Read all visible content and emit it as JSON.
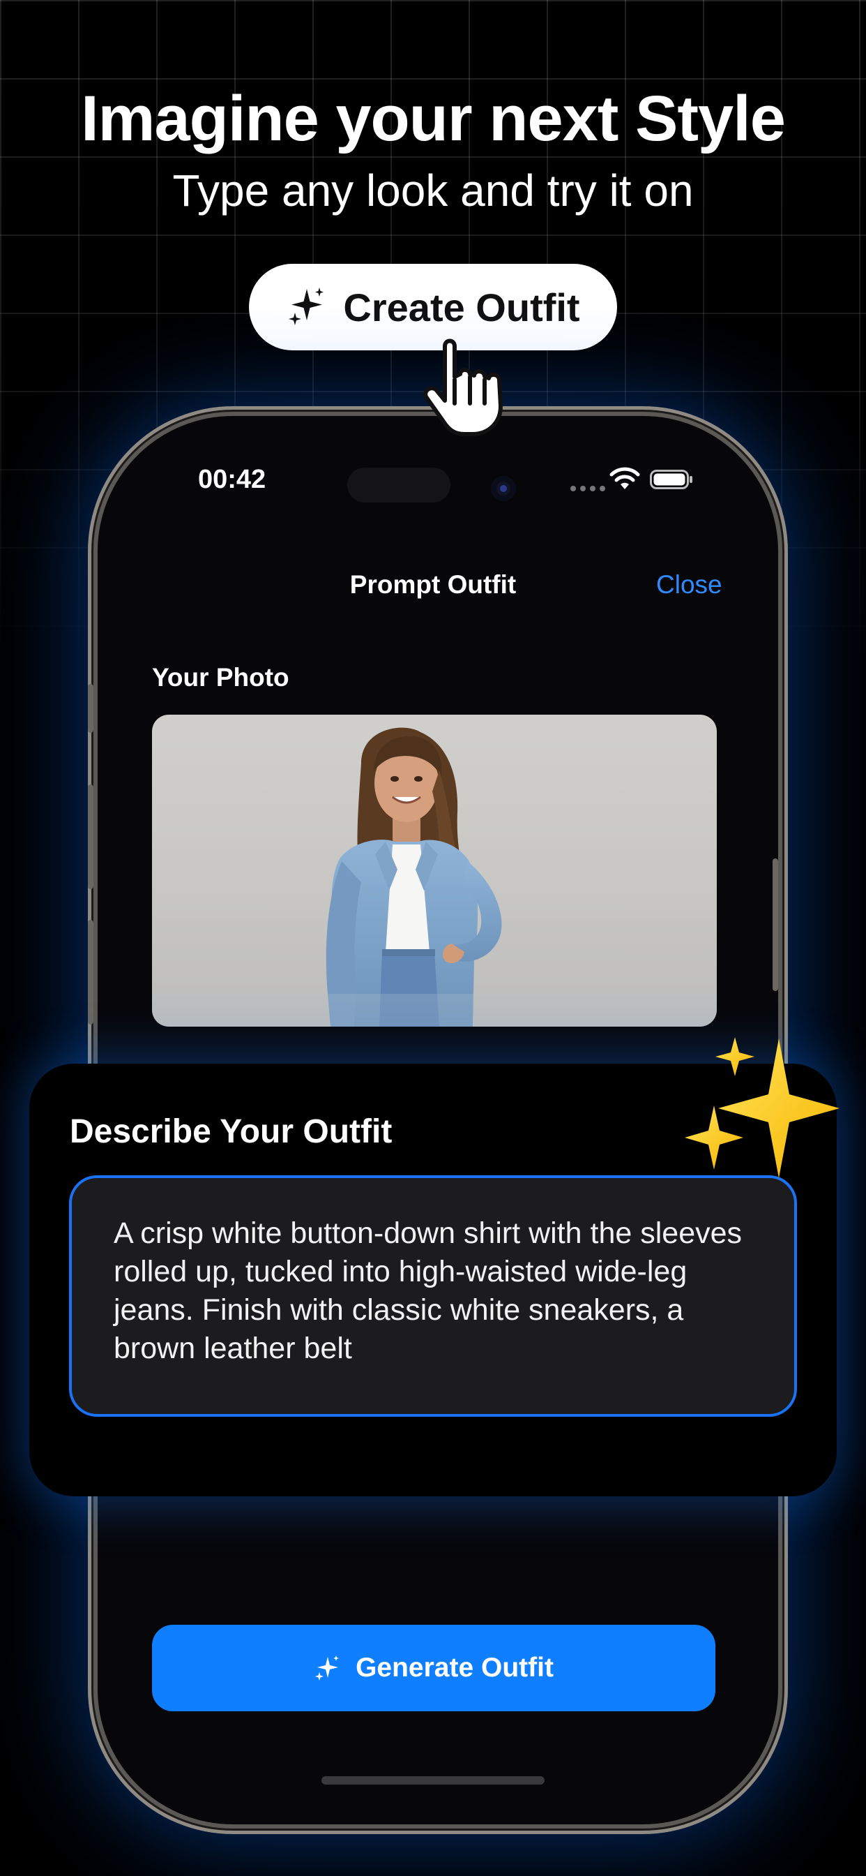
{
  "promo": {
    "headline": "Imagine your next Style",
    "subline": "Type any look and try it on",
    "create_button_label": "Create Outfit"
  },
  "status_bar": {
    "time": "00:42"
  },
  "nav": {
    "title": "Prompt Outfit",
    "close_label": "Close"
  },
  "photo_section": {
    "label": "Your Photo"
  },
  "describe": {
    "title": "Describe Your Outfit",
    "prompt_text": "A crisp white button-down shirt with the sleeves rolled up, tucked into high-waisted wide-leg jeans. Finish with classic white sneakers, a brown leather belt"
  },
  "generate_button_label": "Generate Outfit",
  "colors": {
    "accent_blue": "#0f7fff",
    "link_blue": "#2f8bff",
    "sparkle_yellow": "#ffd21f"
  },
  "icons": [
    "sparkle-icon",
    "hand-cursor-icon",
    "wifi-icon",
    "battery-icon"
  ]
}
